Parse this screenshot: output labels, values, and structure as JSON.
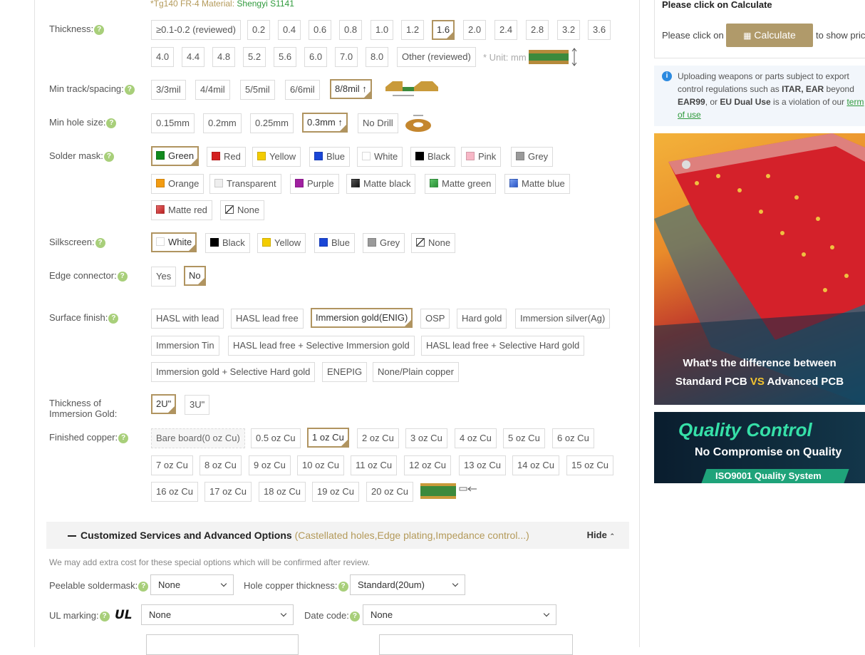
{
  "material_note": {
    "prefix": "*Tg140 FR-4 Material: ",
    "value": "Shengyi S1141"
  },
  "help_symbol": "?",
  "thickness": {
    "label": "Thickness:",
    "options": [
      "≥0.1-0.2 (reviewed)",
      "0.2",
      "0.4",
      "0.6",
      "0.8",
      "1.0",
      "1.2",
      "1.6",
      "2.0",
      "2.4",
      "2.8",
      "3.2",
      "3.6",
      "4.0",
      "4.4",
      "4.8",
      "5.2",
      "5.6",
      "6.0",
      "7.0",
      "8.0",
      "Other (reviewed)"
    ],
    "selected": "1.6",
    "unit_note": "* Unit: mm"
  },
  "min_track": {
    "label": "Min track/spacing:",
    "options": [
      "3/3mil",
      "4/4mil",
      "5/5mil",
      "6/6mil",
      "8/8mil ↑"
    ],
    "selected": "8/8mil ↑"
  },
  "min_hole": {
    "label": "Min hole size:",
    "options": [
      "0.15mm",
      "0.2mm",
      "0.25mm",
      "0.3mm ↑",
      "No Drill"
    ],
    "selected": "0.3mm ↑"
  },
  "solder_mask": {
    "label": "Solder mask:",
    "options": [
      {
        "name": "Green",
        "color": "#118a1e"
      },
      {
        "name": "Red",
        "color": "#d42020"
      },
      {
        "name": "Yellow",
        "color": "#f3cc00"
      },
      {
        "name": "Blue",
        "color": "#1a46d6"
      },
      {
        "name": "White",
        "color": "#ffffff"
      },
      {
        "name": "Black",
        "color": "#000000"
      },
      {
        "name": "Pink",
        "color": "#f7b7c6"
      },
      {
        "name": "Grey",
        "color": "#9a9a9a"
      },
      {
        "name": "Orange",
        "color": "#f39c12"
      },
      {
        "name": "Transparent",
        "color": "#eeeeee"
      },
      {
        "name": "Purple",
        "color": "#a020a0"
      },
      {
        "name": "Matte black",
        "color": "#222222"
      },
      {
        "name": "Matte green",
        "color": "#3db04a"
      },
      {
        "name": "Matte blue",
        "color": "#3d6de0"
      },
      {
        "name": "Matte red",
        "color": "#d04040"
      },
      {
        "name": "None",
        "color": "none"
      }
    ],
    "selected": "Green"
  },
  "silkscreen": {
    "label": "Silkscreen:",
    "options": [
      {
        "name": "White",
        "color": "#ffffff"
      },
      {
        "name": "Black",
        "color": "#000000"
      },
      {
        "name": "Yellow",
        "color": "#f3cc00"
      },
      {
        "name": "Blue",
        "color": "#1a46d6"
      },
      {
        "name": "Grey",
        "color": "#9a9a9a"
      },
      {
        "name": "None",
        "color": "none"
      }
    ],
    "selected": "White"
  },
  "edge_connector": {
    "label": "Edge connector:",
    "options": [
      "Yes",
      "No"
    ],
    "selected": "No"
  },
  "surface_finish": {
    "label": "Surface finish:",
    "options": [
      "HASL with lead",
      "HASL lead free",
      "Immersion gold(ENIG)",
      "OSP",
      "Hard gold",
      "Immersion silver(Ag)",
      "Immersion Tin",
      "HASL lead free + Selective Immersion gold",
      "HASL lead free + Selective Hard gold",
      "Immersion gold + Selective Hard gold",
      "ENEPIG",
      "None/Plain copper"
    ],
    "selected": "Immersion gold(ENIG)"
  },
  "gold_thickness": {
    "label_line1": "Thickness of",
    "label_line2": "Immersion Gold:",
    "options": [
      "2U\"",
      "3U\""
    ],
    "selected": "2U\""
  },
  "finished_copper": {
    "label": "Finished copper:",
    "options": [
      "Bare board(0 oz Cu)",
      "0.5 oz Cu",
      "1 oz Cu",
      "2 oz Cu",
      "3 oz Cu",
      "4 oz Cu",
      "5 oz Cu",
      "6 oz Cu",
      "7 oz Cu",
      "8 oz Cu",
      "9 oz Cu",
      "10 oz Cu",
      "11 oz Cu",
      "12 oz Cu",
      "13 oz Cu",
      "14 oz Cu",
      "15 oz Cu",
      "16 oz Cu",
      "17 oz Cu",
      "18 oz Cu",
      "19 oz Cu",
      "20 oz Cu"
    ],
    "selected": "1 oz Cu"
  },
  "advanced": {
    "title": "Customized Services and Advanced Options",
    "subtitle": "(Castellated holes,Edge plating,Impedance control...)",
    "toggle": "Hide",
    "note": "We may add extra cost for these special options which will be confirmed after review.",
    "peelable_label": "Peelable soldermask:",
    "peelable_value": "None",
    "hole_copper_label": "Hole copper thickness:",
    "hole_copper_value": "Standard(20um)",
    "ul_label": "UL marking:",
    "ul_value": "None",
    "date_code_label": "Date code:",
    "date_code_value": "None"
  },
  "sidebar": {
    "calc_head": "Please click on Calculate",
    "calc_prefix": "Please click on",
    "calc_button": "Calculate",
    "calc_suffix": "to show pric",
    "notice": {
      "part1": "Uploading weapons or parts subject to export control regulations such as ",
      "b1": "ITAR, EAR",
      "part2": " beyond ",
      "b2": "EAR99",
      "part3": ", or ",
      "b3": "EU Dual Use",
      "part4": " is a violation of our ",
      "link1": "term",
      "link2": "of use"
    },
    "banner1_line1": "What's the difference between",
    "banner1_line2a": "Standard PCB ",
    "banner1_vs": "VS",
    "banner1_line2b": " Advanced PCB",
    "banner2_title": "Quality Control",
    "banner2_sub": "No Compromise on Quality",
    "banner2_badge": "ISO9001 Quality System",
    "colors": {
      "accent_gold": "#b09460",
      "note_gold": "#b49a5a",
      "help_green": "#a8cf7a",
      "link_green": "#2f9a3c",
      "info_blue": "#2c8ae0"
    }
  }
}
